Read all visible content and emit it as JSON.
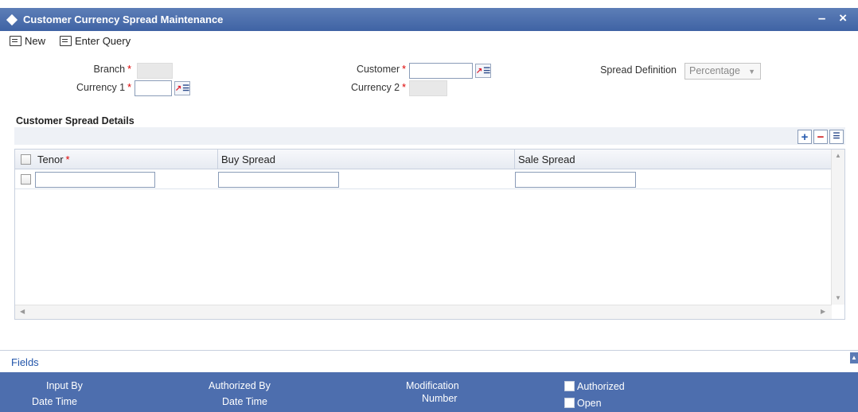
{
  "window": {
    "title": "Customer Currency Spread Maintenance",
    "controls": "– ×"
  },
  "toolbar": {
    "new_label": "New",
    "enter_query_label": "Enter Query"
  },
  "form": {
    "branch_label": "Branch",
    "currency1_label": "Currency 1",
    "customer_label": "Customer",
    "currency2_label": "Currency 2",
    "spread_definition_label": "Spread Definition",
    "spread_definition_value": "Percentage",
    "required_mark": "*",
    "lov_icon": "lov-icon"
  },
  "details": {
    "section_title": "Customer Spread Details",
    "columns": [
      "Tenor",
      "Buy Spread",
      "Sale Spread"
    ],
    "rows": [
      {
        "tenor": "",
        "buy_spread": "",
        "sale_spread": ""
      }
    ]
  },
  "fields_bar": {
    "label": "Fields"
  },
  "footer": {
    "input_by": "Input By",
    "date_time_1": "Date Time",
    "authorized_by": "Authorized By",
    "date_time_2": "Date Time",
    "modification": "Modification",
    "number": "Number",
    "authorized": "Authorized",
    "open": "Open"
  },
  "colors": {
    "title_bar": "#3f63a4",
    "footer": "#4d6eae",
    "required": "#dd0000",
    "link": "#2255aa"
  }
}
